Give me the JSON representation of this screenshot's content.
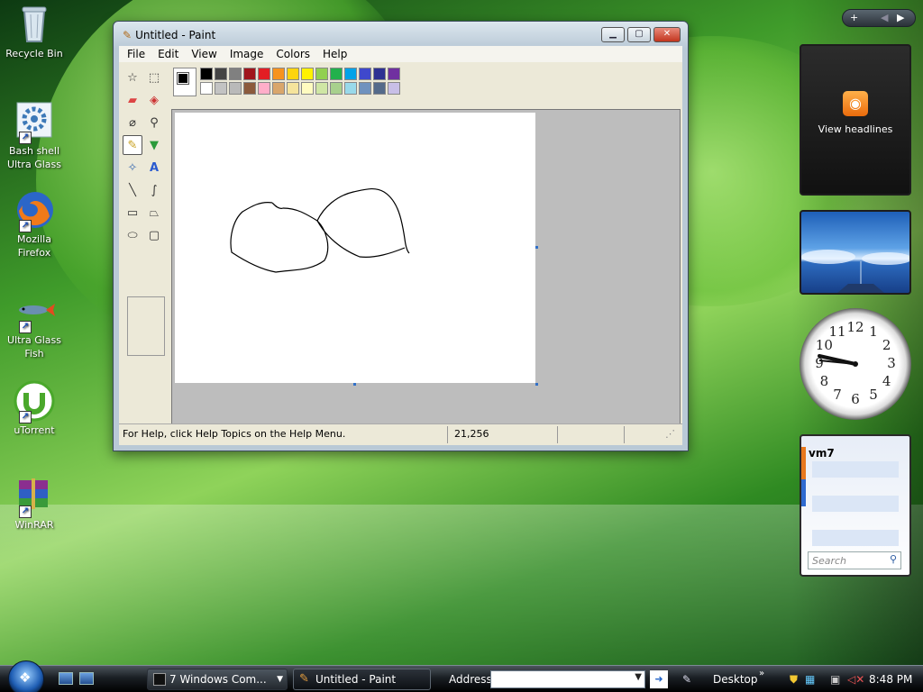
{
  "desktop": {
    "icons": [
      {
        "label_line1": "Recycle Bin",
        "label_line2": "",
        "icon": "recycle-bin-icon"
      },
      {
        "label_line1": "Bash shell",
        "label_line2": "Ultra Glass",
        "icon": "gear-shell-icon"
      },
      {
        "label_line1": "Mozilla",
        "label_line2": "Firefox",
        "icon": "firefox-icon"
      },
      {
        "label_line1": "Ultra Glass",
        "label_line2": "Fish",
        "icon": "fish-icon"
      },
      {
        "label_line1": "uTorrent",
        "label_line2": "",
        "icon": "utorrent-icon"
      },
      {
        "label_line1": "WinRAR",
        "label_line2": "",
        "icon": "winrar-icon"
      }
    ]
  },
  "paint": {
    "title": "Untitled - Paint",
    "menu": [
      "File",
      "Edit",
      "View",
      "Image",
      "Colors",
      "Help"
    ],
    "palette_top": [
      "#000000",
      "#444444",
      "#808080",
      "#a0161b",
      "#e31e24",
      "#f7931e",
      "#fdd40e",
      "#fff200",
      "#92d050",
      "#22b14c",
      "#00a2e8",
      "#3f48cc",
      "#2e3192",
      "#7030a0"
    ],
    "palette_bottom": [
      "#ffffff",
      "#c3c3c3",
      "#b9b9b9",
      "#8b5a3c",
      "#ffaec9",
      "#d9a66b",
      "#f5e49c",
      "#fffbc0",
      "#cfe6a4",
      "#a8d08d",
      "#99d9ea",
      "#7092be",
      "#546a8a",
      "#c8bfe7"
    ],
    "foreground_color": "#000000",
    "background_color": "#ffffff",
    "status_help": "For Help, click Help Topics on the Help Menu.",
    "status_coords": "21,256"
  },
  "sidebar": {
    "feed_label": "View headlines",
    "contacts_name": "vm7",
    "contacts_search_placeholder": "Search",
    "clock_numbers": [
      "12",
      "1",
      "2",
      "3",
      "4",
      "5",
      "6",
      "7",
      "8",
      "9",
      "10",
      "11"
    ]
  },
  "taskbar": {
    "tasks": [
      "7 Windows Com...",
      "Untitled - Paint"
    ],
    "address_label": "Address",
    "desktop_label": "Desktop",
    "time": "8:48 PM"
  }
}
